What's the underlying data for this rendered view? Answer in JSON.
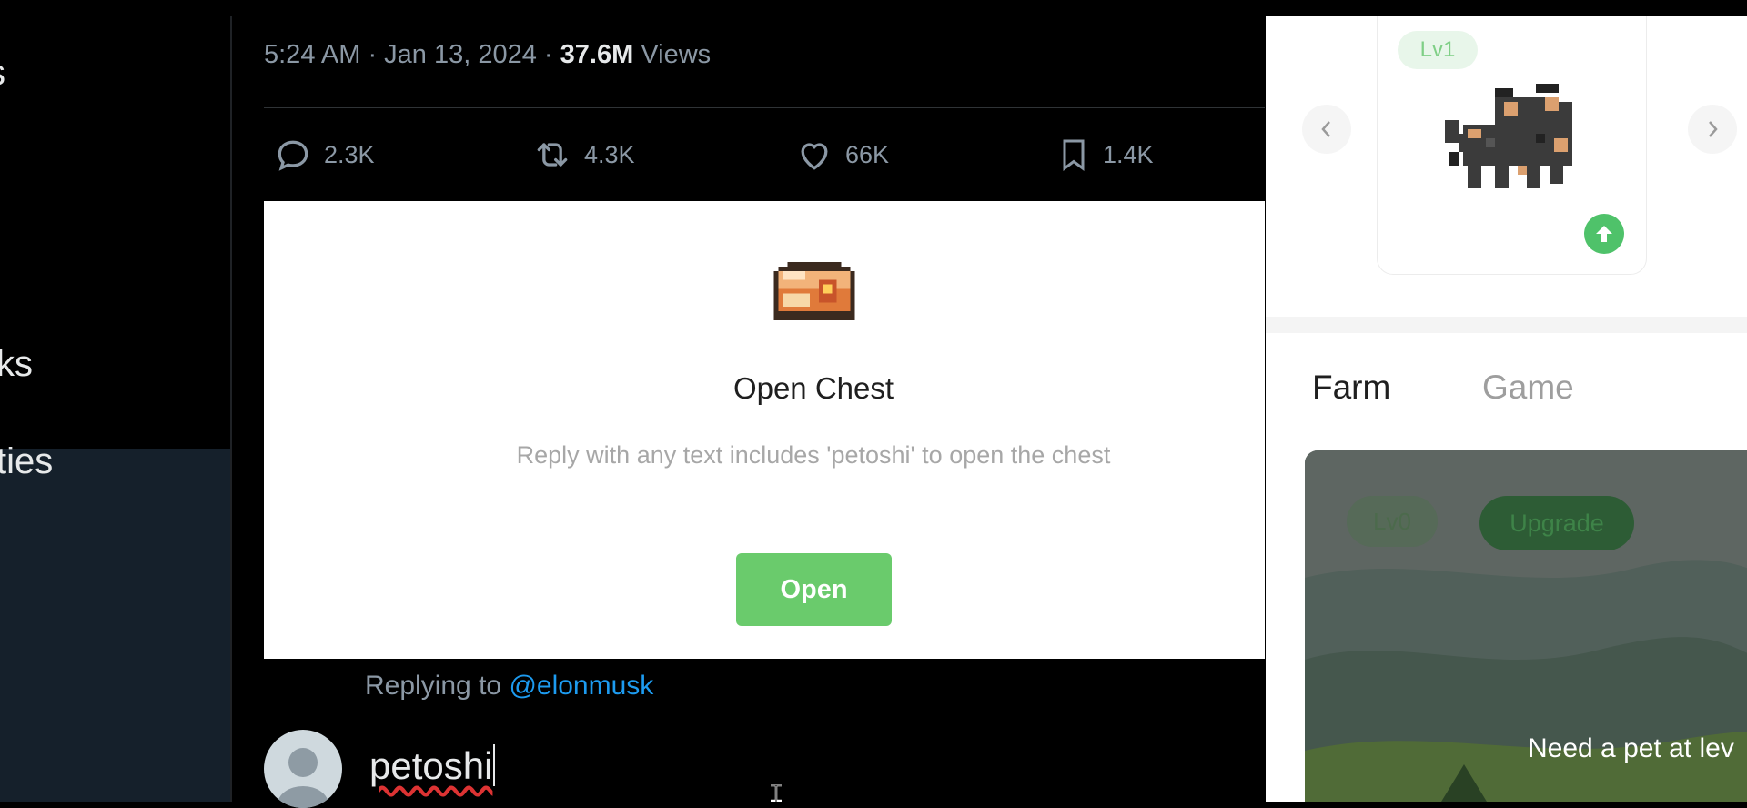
{
  "sidebar": {
    "items": [
      {
        "label": "s"
      },
      {
        "label": "ks"
      },
      {
        "label": "ties"
      }
    ]
  },
  "tweet": {
    "time_date": "5:24 AM · Jan 13, 2024 · ",
    "views_count": "37.6M",
    "views_label": " Views",
    "actions": {
      "replies": "2.3K",
      "reposts": "4.3K",
      "likes": "66K",
      "bookmarks": "1.4K"
    }
  },
  "chest": {
    "title": "Open Chest",
    "description": "Reply with any text includes 'petoshi' to open the chest",
    "button_label": "Open"
  },
  "reply": {
    "replying_prefix": "Replying to ",
    "replying_handle": "@elonmusk",
    "input_value": "petoshi"
  },
  "pet_panel": {
    "level_badge": "Lv1",
    "tabs": [
      {
        "label": "Farm",
        "active": true
      },
      {
        "label": "Game",
        "active": false
      }
    ],
    "farm": {
      "level_label": "Lv0",
      "upgrade_label": "Upgrade",
      "note": "Need a pet at lev"
    }
  },
  "colors": {
    "accent_green": "#6acb6c",
    "link_blue": "#1d9bf0",
    "sidebar_navy": "#15202b"
  },
  "icons": [
    "reply-icon",
    "repost-icon",
    "like-icon",
    "bookmark-icon",
    "chest-icon",
    "pet-sprite",
    "chevron-left-icon",
    "chevron-right-icon",
    "upgrade-arrow-icon",
    "avatar-placeholder-icon",
    "text-cursor-icon"
  ]
}
